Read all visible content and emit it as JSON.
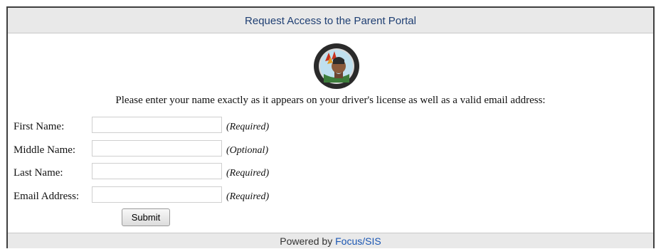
{
  "header": {
    "title": "Request Access to the Parent Portal"
  },
  "instructions": "Please enter your name exactly as it appears on your driver's license as well as a valid email address:",
  "form": {
    "fields": [
      {
        "label": "First Name:",
        "value": "",
        "hint": "(Required)"
      },
      {
        "label": "Middle Name:",
        "value": "",
        "hint": "(Optional)"
      },
      {
        "label": "Last Name:",
        "value": "",
        "hint": "(Required)"
      },
      {
        "label": "Email Address:",
        "value": "",
        "hint": "(Required)"
      }
    ],
    "submit_label": "Submit"
  },
  "footer": {
    "prefix": "Powered by ",
    "link": "Focus/SIS"
  },
  "colors": {
    "header_text": "#1f3f73",
    "link": "#1a56b3",
    "header_bg": "#e9e9e9"
  }
}
